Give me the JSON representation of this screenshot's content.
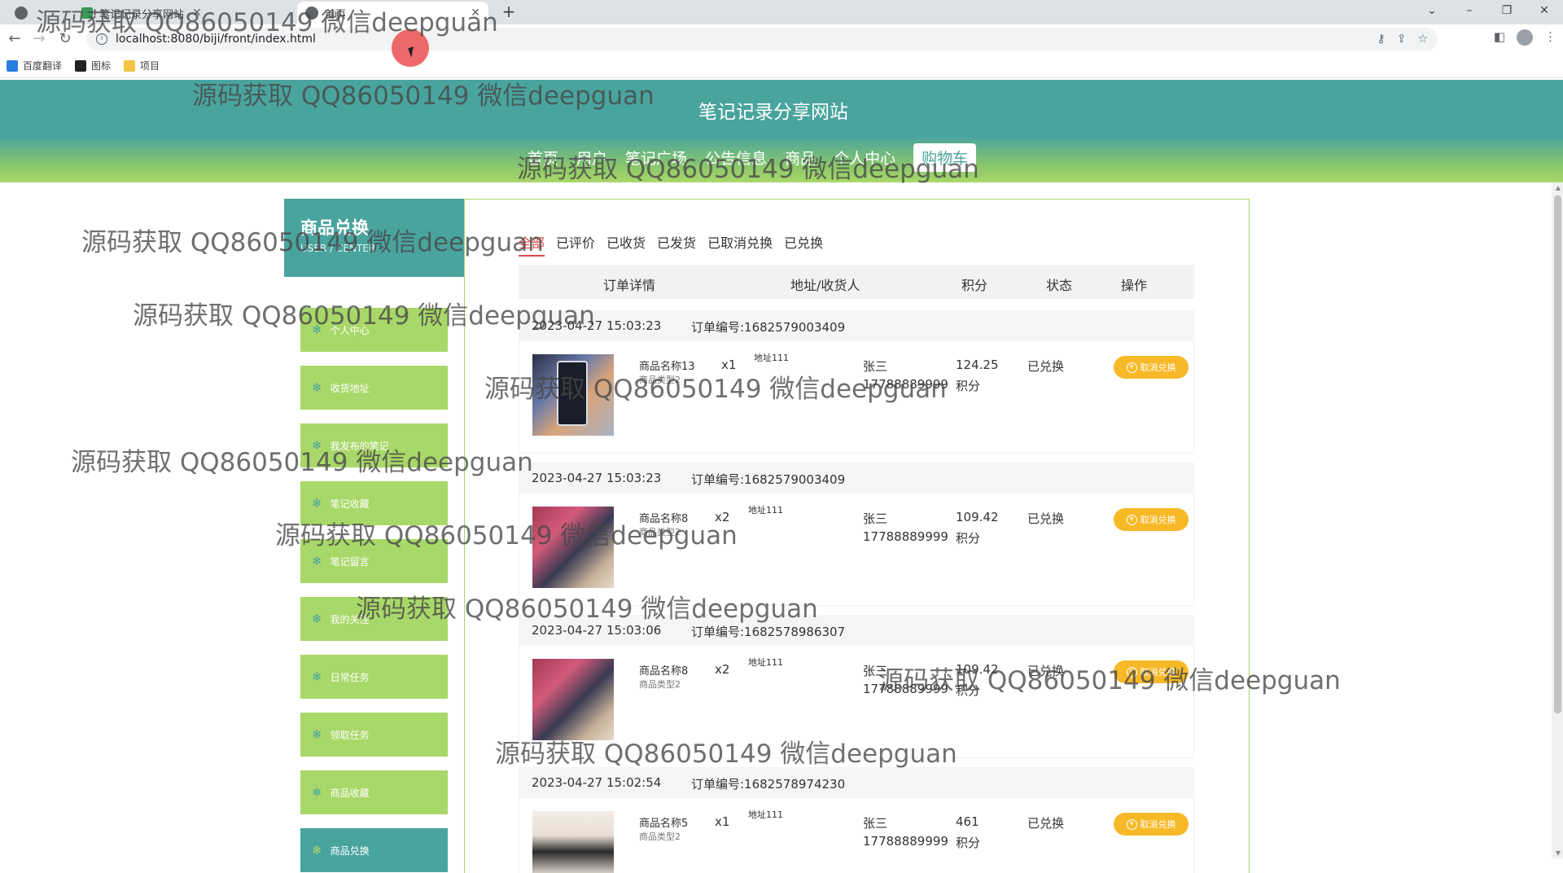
{
  "browser": {
    "tabs": [
      {
        "label": ""
      },
      {
        "label": "笔记记录分享网站"
      },
      {
        "label": "首页"
      }
    ],
    "url": "localhost:8080/biji/front/index.html",
    "bookmarks": [
      "百度翻译",
      "图标",
      "项目"
    ]
  },
  "site": {
    "title": "笔记记录分享网站",
    "nav": [
      "首页",
      "用户",
      "笔记广场",
      "公告信息",
      "商品",
      "个人中心",
      "购物车"
    ]
  },
  "sidebar": {
    "title": "商品兑换",
    "subtitle": "USER / CENTER",
    "items": [
      "个人中心",
      "收货地址",
      "我发布的笔记",
      "笔记收藏",
      "笔记留言",
      "我的关注",
      "日常任务",
      "领取任务",
      "商品收藏",
      "商品兑换"
    ]
  },
  "order_tabs": [
    "全部",
    "已评价",
    "已收货",
    "已发货",
    "已取消兑换",
    "已兑换"
  ],
  "table_headers": [
    "订单详情",
    "地址/收货人",
    "积分",
    "状态",
    "操作"
  ],
  "orders": [
    {
      "time": "2023-04-27 15:03:23",
      "order_no": "订单编号:1682579003409",
      "product": "商品名称13",
      "type": "商品类型2",
      "qty": "x1",
      "address": "地址111",
      "receiver": "张三",
      "phone": "17788889999",
      "points": "124.25",
      "unit": "积分",
      "status": "已兑换",
      "action": "取消兑换"
    },
    {
      "time": "2023-04-27 15:03:23",
      "order_no": "订单编号:1682579003409",
      "product": "商品名称8",
      "type": "商品类型2",
      "qty": "x2",
      "address": "地址111",
      "receiver": "张三",
      "phone": "17788889999",
      "points": "109.42",
      "unit": "积分",
      "status": "已兑换",
      "action": "取消兑换"
    },
    {
      "time": "2023-04-27 15:03:06",
      "order_no": "订单编号:1682578986307",
      "product": "商品名称8",
      "type": "商品类型2",
      "qty": "x2",
      "address": "地址111",
      "receiver": "张三",
      "phone": "17788889999",
      "points": "109.42",
      "unit": "积分",
      "status": "已兑换",
      "action": "取消兑换"
    },
    {
      "time": "2023-04-27 15:02:54",
      "order_no": "订单编号:1682578974230",
      "product": "商品名称5",
      "type": "商品类型2",
      "qty": "x1",
      "address": "地址111",
      "receiver": "张三",
      "phone": "17788889999",
      "points": "461",
      "unit": "积分",
      "status": "已兑换",
      "action": "取消兑换"
    }
  ],
  "watermark": "源码获取 QQ86050149 微信deepguan",
  "colors": {
    "teal": "#4aa49e",
    "green": "#a9d86a",
    "accent_red": "#e84545",
    "button_yellow": "#f7b928"
  }
}
